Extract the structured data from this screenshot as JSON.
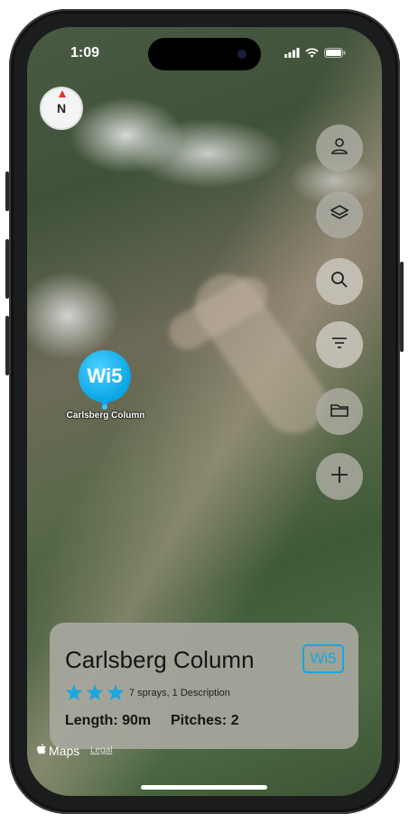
{
  "status_bar": {
    "time": "1:09"
  },
  "compass": {
    "label": "N"
  },
  "toolbar": [
    {
      "name": "profile-button",
      "icon": "person-icon"
    },
    {
      "name": "layers-button",
      "icon": "layers-icon"
    },
    {
      "name": "search-button",
      "icon": "search-icon"
    },
    {
      "name": "filter-button",
      "icon": "filter-icon"
    },
    {
      "name": "folder-button",
      "icon": "folder-icon"
    },
    {
      "name": "add-button",
      "icon": "plus-icon"
    }
  ],
  "map_pin": {
    "grade": "Wi5",
    "label": "Carlsberg Column",
    "color": "#0aa6e6"
  },
  "route_card": {
    "title": "Carlsberg Column",
    "grade": "Wi5",
    "rating": 3,
    "rating_max": 3,
    "sprays_text": "7 sprays, 1 Description",
    "length_text": "Length: 90m",
    "pitches_text": "Pitches: 2",
    "accent": "#1aa6e0"
  },
  "attribution": {
    "maps_text": "Maps",
    "legal_text": "Legal"
  }
}
